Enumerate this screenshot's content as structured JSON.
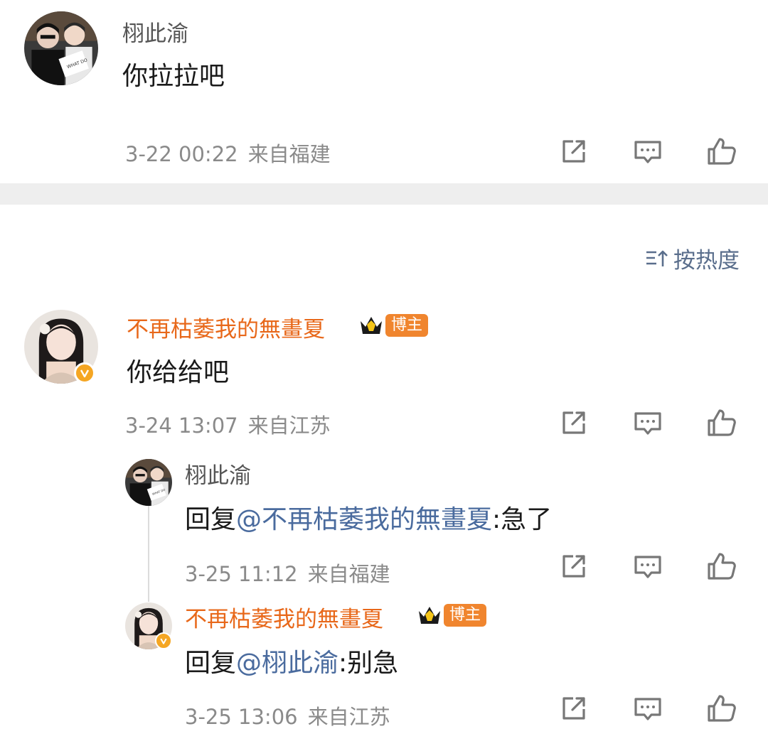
{
  "comment1": {
    "author": "栩此渝",
    "text": "你拉拉吧",
    "time": "3-22 00:22",
    "location": "来自福建"
  },
  "sort": {
    "label": "按热度",
    "icon": "sort-icon"
  },
  "comment2": {
    "author": "不再枯萎我的無畫夏",
    "badge": "博主",
    "text": "你给给吧",
    "time": "3-24 13:07",
    "location": "来自江苏"
  },
  "reply1": {
    "author": "栩此渝",
    "prefix": "回复",
    "mention": "@不再枯萎我的無畫夏",
    "text": ":急了",
    "time": "3-25 11:12",
    "location": "来自福建"
  },
  "reply2": {
    "author": "不再枯萎我的無畫夏",
    "badge": "博主",
    "prefix": "回复",
    "mention": "@栩此渝",
    "text": ":别急",
    "time": "3-25 13:06",
    "location": "来自江苏"
  },
  "colors": {
    "blogger_name": "#e8681a",
    "mention": "#4a6b9e",
    "meta": "#8a8a8a",
    "badge_bg": "#f0852e",
    "verified": "#f5a623"
  }
}
